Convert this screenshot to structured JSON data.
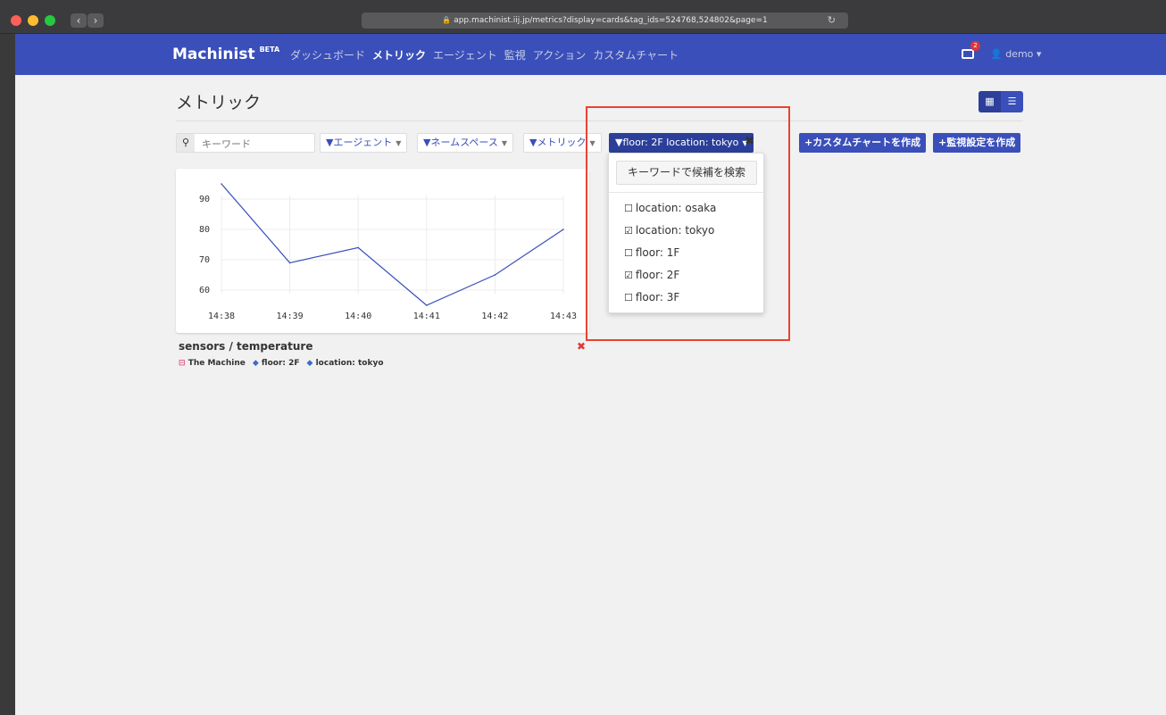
{
  "browser": {
    "url": "app.machinist.iij.jp/metrics?display=cards&tag_ids=524768,524802&page=1",
    "back_icon": "chevron-left-icon",
    "forward_icon": "chevron-right-icon"
  },
  "navbar": {
    "brand": "Machinist",
    "brand_badge": "BETA",
    "links": [
      "ダッシュボード",
      "メトリック",
      "エージェント",
      "監視",
      "アクション",
      "カスタムチャート"
    ],
    "active_link": "メトリック",
    "notification_count": "2",
    "user": "demo"
  },
  "page": {
    "title": "メトリック",
    "search_placeholder": "キーワード",
    "filters": {
      "agent": "エージェント",
      "namespace": "ネームスペース",
      "metric": "メトリック",
      "tag": "floor: 2F location: tokyo"
    },
    "actions": {
      "custom_chart": "カスタムチャートを作成",
      "monitor": "監視設定を作成"
    }
  },
  "dropdown": {
    "search_label": "キーワードで候補を検索",
    "options": [
      {
        "label": "location: osaka",
        "checked": false
      },
      {
        "label": "location: tokyo",
        "checked": true
      },
      {
        "label": "floor: 1F",
        "checked": false
      },
      {
        "label": "floor: 2F",
        "checked": true
      },
      {
        "label": "floor: 3F",
        "checked": false
      }
    ]
  },
  "card": {
    "title": "sensors / temperature",
    "agent": "The Machine",
    "tags": [
      "floor: 2F",
      "location: tokyo"
    ]
  },
  "chart_data": {
    "type": "line",
    "categories": [
      "14:38",
      "14:39",
      "14:40",
      "14:41",
      "14:42",
      "14:43"
    ],
    "y_ticks": [
      60,
      70,
      80,
      90
    ],
    "series": [
      {
        "values": [
          95,
          69,
          74,
          55,
          65,
          80
        ]
      }
    ],
    "ylim": [
      50,
      100
    ],
    "grid": true,
    "line_color": "#3a4fb9"
  }
}
